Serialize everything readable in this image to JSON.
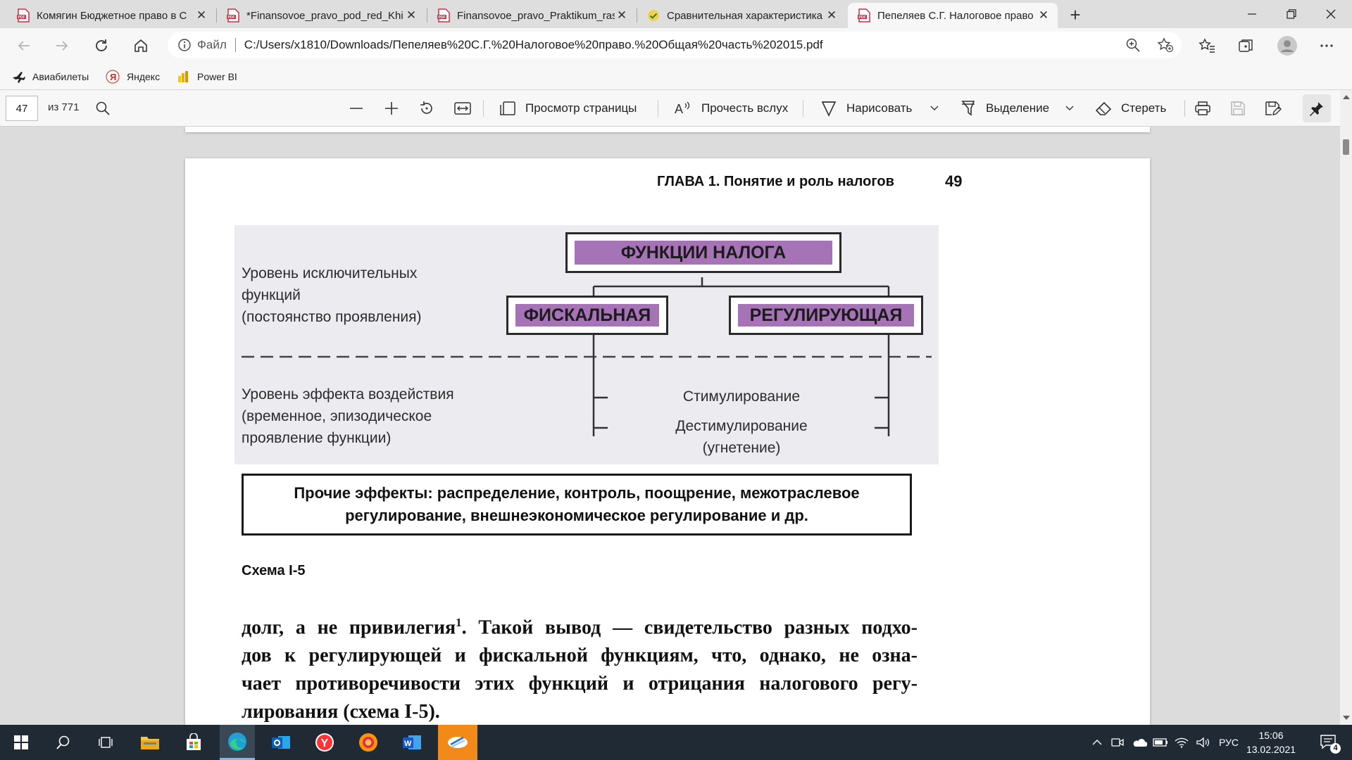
{
  "browser": {
    "tabs": [
      {
        "title": "Комягин Бюджетное право в С",
        "icon": "pdf-icon",
        "active": false
      },
      {
        "title": "*Finansovoe_pravo_pod_red_Khi",
        "icon": "pdf-icon",
        "active": false
      },
      {
        "title": "Finansovoe_pravo_Praktikum_ras",
        "icon": "pdf-icon",
        "active": false
      },
      {
        "title": "Сравнительная характеристика",
        "icon": "check-icon",
        "active": false
      },
      {
        "title": "Пепеляев С.Г. Налоговое право",
        "icon": "pdf-icon",
        "active": true
      }
    ],
    "address": {
      "scheme_label": "Файл",
      "url": "C:/Users/x1810/Downloads/Пепеляев%20С.Г.%20Налоговое%20право.%20Общая%20часть%202015.pdf"
    },
    "favorites": [
      {
        "label": "Авиабилеты",
        "icon": "plane-icon"
      },
      {
        "label": "Яндекс",
        "icon": "yandex-icon"
      },
      {
        "label": "Power BI",
        "icon": "powerbi-icon"
      }
    ]
  },
  "pdf_toolbar": {
    "page_current": "47",
    "page_total": "из 771",
    "page_view": "Просмотр страницы",
    "read_aloud": "Прочесть вслух",
    "draw": "Нарисовать",
    "highlight": "Выделение",
    "erase": "Стереть"
  },
  "document": {
    "running_head": "ГЛАВА 1. Понятие и роль налогов",
    "page_number": "49",
    "scheme": {
      "title": "ФУНКЦИИ НАЛОГА",
      "fiscal": "ФИСКАЛЬНАЯ",
      "regulating": "РЕГУЛИРУЮЩАЯ",
      "level1": [
        "Уровень исключительных",
        "функций",
        "(постоянство проявления)"
      ],
      "level2": [
        "Уровень эффекта воздействия",
        "(временное, эпизодическое",
        "проявление функции)"
      ],
      "effect1": "Стимулирование",
      "effect2": [
        "Дестимулирование",
        "(угнетение)"
      ],
      "others": [
        "Прочие эффекты: распределение, контроль, поощрение, межотраслевое",
        "регулирование, внешнеэкономическое регулирование и др."
      ]
    },
    "caption": "Схема I-5",
    "body": {
      "line1_pre": "долг, а не привилегия",
      "footnote": "1",
      "line1_post": ". Такой вывод — свидетельство разных подхо-",
      "line2": "дов к регулирующей и фискальной функциям, что, однако, не озна-",
      "line3": "чает противоречивости этих функций и отрицания налогового регу-",
      "line4": "лирования (схема I-5)."
    }
  },
  "taskbar": {
    "language": "РУС",
    "time": "15:06",
    "date": "13.02.2021",
    "notifications": "4"
  }
}
